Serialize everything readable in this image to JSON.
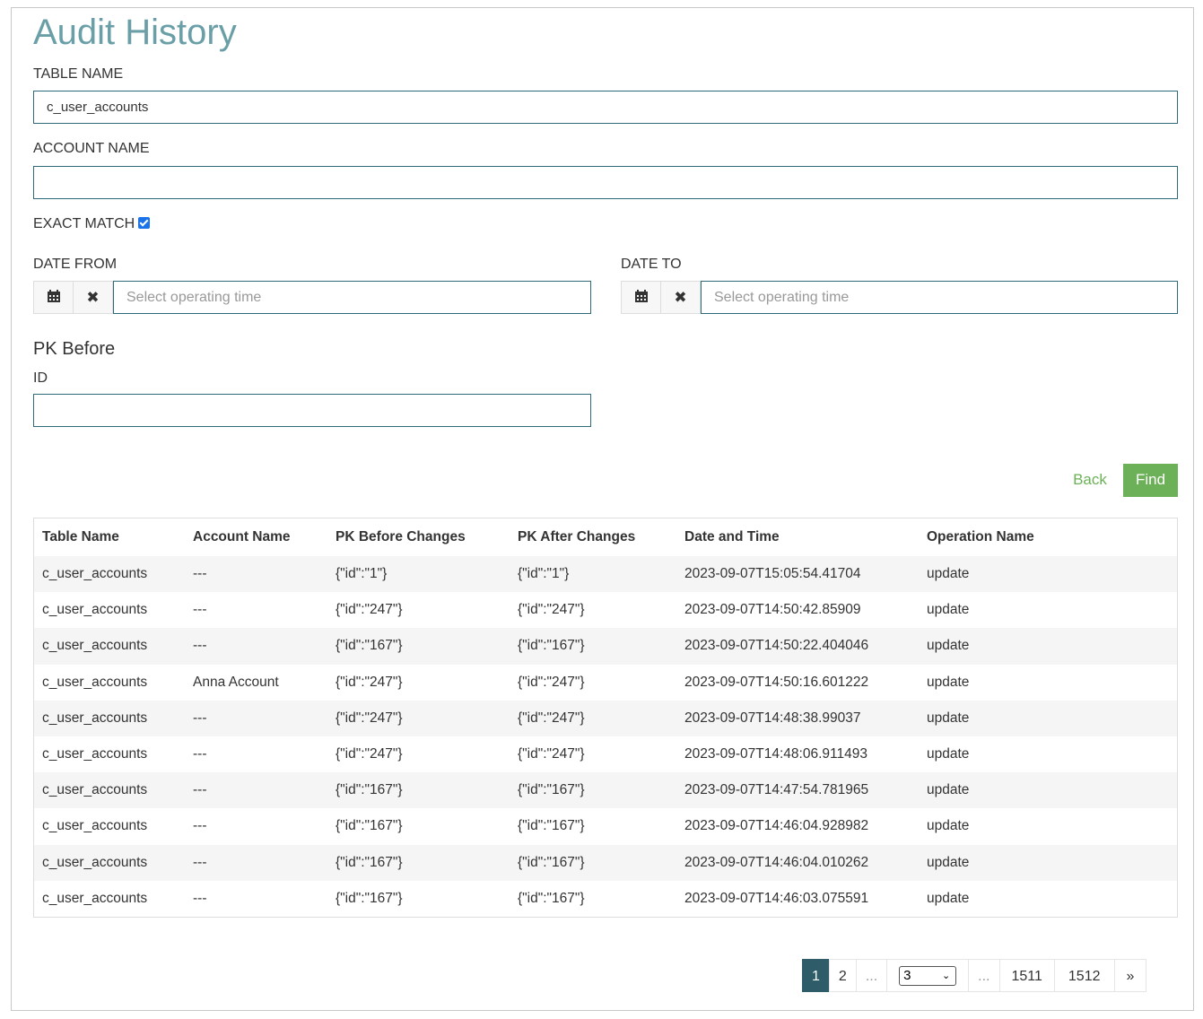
{
  "page": {
    "title": "Audit History"
  },
  "form": {
    "table_name_label": "TABLE NAME",
    "table_name_value": "c_user_accounts",
    "account_name_label": "ACCOUNT NAME",
    "account_name_value": "",
    "exact_match_label": "EXACT MATCH",
    "exact_match_checked": true,
    "date_from_label": "DATE FROM",
    "date_from_placeholder": "Select operating time",
    "date_to_label": "DATE TO",
    "date_to_placeholder": "Select operating time",
    "pk_before_heading": "PK Before",
    "id_label": "ID",
    "id_value": ""
  },
  "actions": {
    "back_label": "Back",
    "find_label": "Find"
  },
  "table": {
    "headers": [
      "Table Name",
      "Account Name",
      "PK Before Changes",
      "PK After Changes",
      "Date and Time",
      "Operation Name"
    ],
    "rows": [
      [
        "c_user_accounts",
        "---",
        "{\"id\":\"1\"}",
        "{\"id\":\"1\"}",
        "2023-09-07T15:05:54.41704",
        "update"
      ],
      [
        "c_user_accounts",
        "---",
        "{\"id\":\"247\"}",
        "{\"id\":\"247\"}",
        "2023-09-07T14:50:42.85909",
        "update"
      ],
      [
        "c_user_accounts",
        "---",
        "{\"id\":\"167\"}",
        "{\"id\":\"167\"}",
        "2023-09-07T14:50:22.404046",
        "update"
      ],
      [
        "c_user_accounts",
        "Anna Account",
        "{\"id\":\"247\"}",
        "{\"id\":\"247\"}",
        "2023-09-07T14:50:16.601222",
        "update"
      ],
      [
        "c_user_accounts",
        "---",
        "{\"id\":\"247\"}",
        "{\"id\":\"247\"}",
        "2023-09-07T14:48:38.99037",
        "update"
      ],
      [
        "c_user_accounts",
        "---",
        "{\"id\":\"247\"}",
        "{\"id\":\"247\"}",
        "2023-09-07T14:48:06.911493",
        "update"
      ],
      [
        "c_user_accounts",
        "---",
        "{\"id\":\"167\"}",
        "{\"id\":\"167\"}",
        "2023-09-07T14:47:54.781965",
        "update"
      ],
      [
        "c_user_accounts",
        "---",
        "{\"id\":\"167\"}",
        "{\"id\":\"167\"}",
        "2023-09-07T14:46:04.928982",
        "update"
      ],
      [
        "c_user_accounts",
        "---",
        "{\"id\":\"167\"}",
        "{\"id\":\"167\"}",
        "2023-09-07T14:46:04.010262",
        "update"
      ],
      [
        "c_user_accounts",
        "---",
        "{\"id\":\"167\"}",
        "{\"id\":\"167\"}",
        "2023-09-07T14:46:03.075591",
        "update"
      ]
    ]
  },
  "pagination": {
    "first": "1",
    "second": "2",
    "ellipsis": "...",
    "select_value": "3",
    "second_last": "1511",
    "last": "1512",
    "next": "»"
  },
  "icons": {
    "calendar": "calendar-icon",
    "clear": "close-icon"
  },
  "colors": {
    "title": "#6a9fa8",
    "accent_green": "#6cb157",
    "input_border": "#2e6b79",
    "active_page": "#2e5c68"
  }
}
